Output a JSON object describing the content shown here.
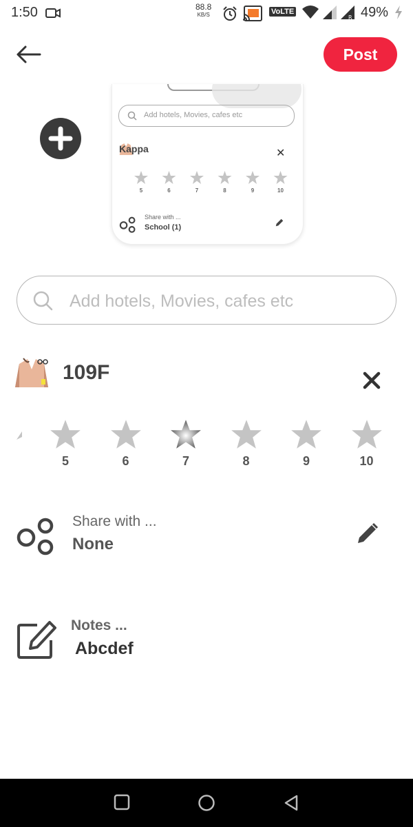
{
  "status_bar": {
    "time": "1:50",
    "net_speed_value": "88.8",
    "net_speed_unit": "KB/S",
    "volte": "VoLTE",
    "battery": "49%",
    "icons": [
      "video-camera-icon",
      "alarm-icon",
      "cast-icon",
      "wifi-icon",
      "signal-icon",
      "signal-roaming-icon",
      "charging-icon"
    ]
  },
  "header": {
    "post_label": "Post"
  },
  "preview": {
    "search_placeholder": "Add hotels, Movies, cafes etc",
    "item_name": "Kappa",
    "ratings": [
      "5",
      "6",
      "7",
      "8",
      "9",
      "10"
    ],
    "share_label": "Share with ...",
    "share_value": "School  (1)"
  },
  "search": {
    "placeholder": "Add hotels, Movies, cafes etc"
  },
  "item": {
    "title": "109F"
  },
  "rating": {
    "options": [
      "5",
      "6",
      "7",
      "8",
      "9",
      "10"
    ],
    "selected": "7",
    "colors": {
      "default": "#c4c4c4",
      "selected": "#5a5a5a"
    }
  },
  "share": {
    "label": "Share with ...",
    "value": "None"
  },
  "notes": {
    "label": "Notes ...",
    "value": "Abcdef"
  },
  "accent_color": "#f0243f"
}
